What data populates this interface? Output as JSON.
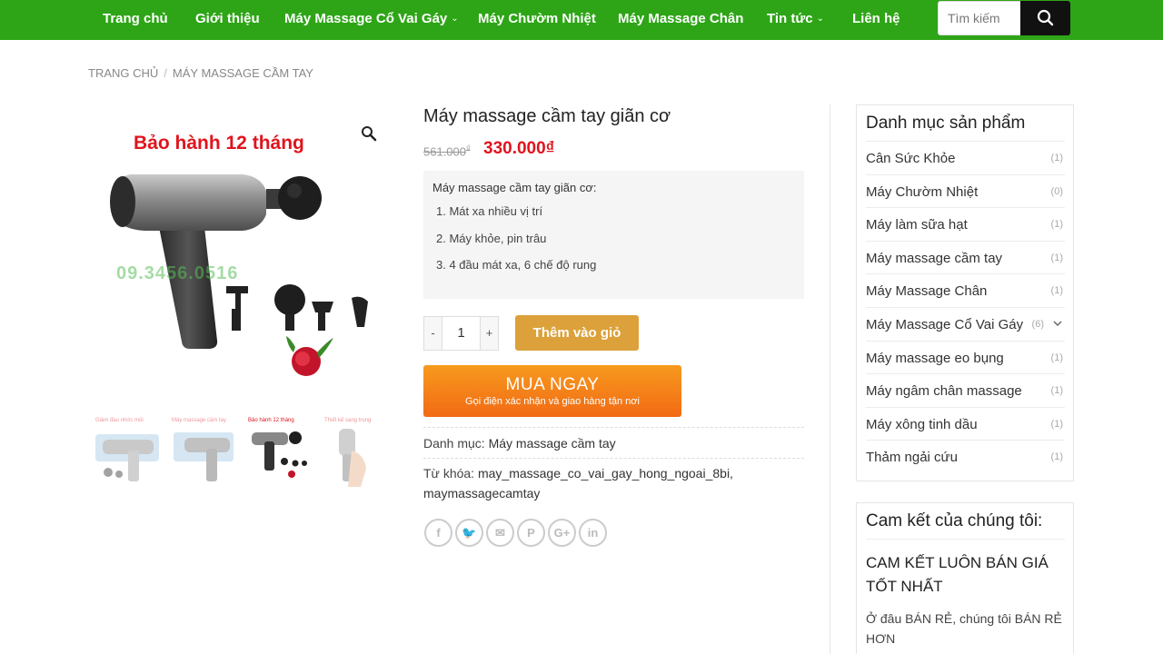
{
  "nav": {
    "items": [
      {
        "label": "Trang chủ",
        "has_dropdown": false
      },
      {
        "label": "Giới thiệu",
        "has_dropdown": false
      },
      {
        "label": "Máy Massage Cổ Vai Gáy",
        "has_dropdown": true
      },
      {
        "label": "Máy Chườm Nhiệt",
        "has_dropdown": false
      },
      {
        "label": "Máy Massage Chân",
        "has_dropdown": false
      },
      {
        "label": "Tin tức",
        "has_dropdown": true
      },
      {
        "label": "Liên hệ",
        "has_dropdown": false
      }
    ],
    "search_placeholder": "Tìm kiếm",
    "bar_color": "#2ea517"
  },
  "breadcrumb": {
    "home": "TRANG CHỦ",
    "separator": "/",
    "current": "MÁY MASSAGE CẦM TAY"
  },
  "gallery": {
    "main_caption": "Bảo hành 12 tháng",
    "watermark": "09.3456.0516",
    "thumbnails": [
      {
        "caption": "Giảm đau nhức mỏi",
        "active": false
      },
      {
        "caption": "Máy massage cầm tay",
        "active": false
      },
      {
        "caption": "Bảo hành 12 tháng",
        "active": true
      },
      {
        "caption": "Thiết kế sang trọng",
        "active": false
      }
    ]
  },
  "product": {
    "title": "Máy massage cầm tay giãn cơ",
    "old_price": "561.000",
    "old_price_currency": "₫",
    "new_price": "330.000₫",
    "desc_title": "Máy massage cầm tay giãn cơ:",
    "features": [
      "1. Mát xa nhiều vị trí",
      "2. Máy khỏe, pin trâu",
      "3. 4 đầu mát xa, 6 chế độ rung"
    ],
    "qty_minus": "-",
    "qty_value": "1",
    "qty_plus": "+",
    "add_to_cart": "Thêm vào giỏ",
    "buy_now": "MUA NGAY",
    "buy_now_sub": "Gọi điện xác nhận và giao hàng tận nơi",
    "category_label": "Danh mục:",
    "category_value": "Máy massage cầm tay",
    "tags_label": "Từ khóa:",
    "tags_value": "may_massage_co_vai_gay_hong_ngoai_8bi, maymassagecamtay",
    "share_icons": [
      "facebook-icon",
      "twitter-icon",
      "email-icon",
      "pinterest-icon",
      "google-plus-icon",
      "linkedin-icon"
    ],
    "share_glyphs": [
      "f",
      "🐦",
      "✉",
      "P",
      "G+",
      "in"
    ]
  },
  "sidebar": {
    "categories_title": "Danh mục sản phẩm",
    "categories": [
      {
        "name": "Cân Sức Khỏe",
        "count": "(1)",
        "expandable": false
      },
      {
        "name": "Máy Chườm Nhiệt",
        "count": "(0)",
        "expandable": false
      },
      {
        "name": "Máy làm sữa hạt",
        "count": "(1)",
        "expandable": false
      },
      {
        "name": "Máy massage cầm tay",
        "count": "(1)",
        "expandable": false
      },
      {
        "name": "Máy Massage Chân",
        "count": "(1)",
        "expandable": false
      },
      {
        "name": "Máy Massage Cổ Vai Gáy",
        "count": "(6)",
        "expandable": true
      },
      {
        "name": "Máy massage eo bụng",
        "count": "(1)",
        "expandable": false
      },
      {
        "name": "Máy ngâm chân massage",
        "count": "(1)",
        "expandable": false
      },
      {
        "name": "Máy xông tinh dầu",
        "count": "(1)",
        "expandable": false
      },
      {
        "name": "Thảm ngải cứu",
        "count": "(1)",
        "expandable": false
      }
    ],
    "promise_title": "Cam kết của chúng tôi:",
    "promise_heading": "CAM KẾT LUÔN BÁN GIÁ TỐT NHẤT",
    "promise_text": "Ở đâu BÁN RẺ, chúng tôi BÁN RẺ HƠN"
  }
}
